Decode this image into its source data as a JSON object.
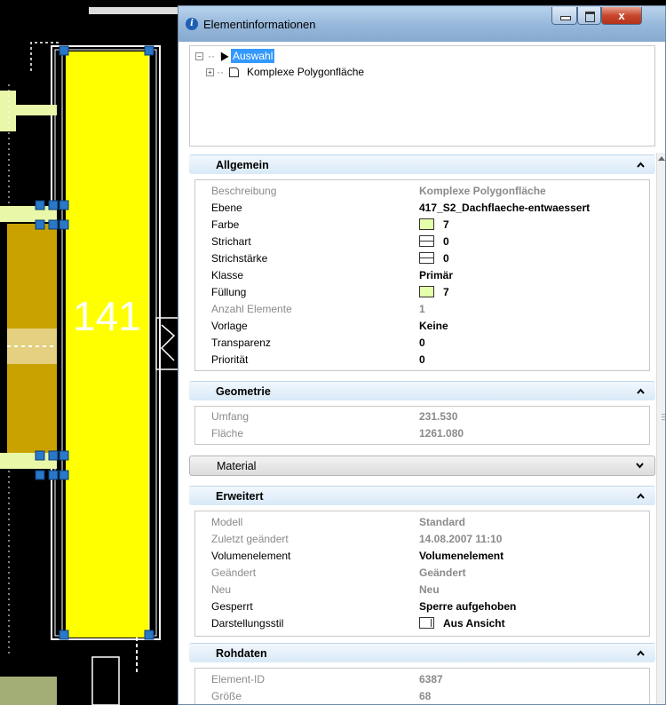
{
  "cad": {
    "label": "141"
  },
  "window": {
    "title": "Elementinformationen",
    "close_glyph": "x",
    "info_glyph": "i",
    "accent_color": "#3399ff",
    "fill_color": "#e6ffab",
    "icons": [
      "info-icon",
      "minimize-icon",
      "maximize-icon",
      "close-icon",
      "cursor-arrow-icon",
      "polygon-icon",
      "chevron-up-icon",
      "chevron-down-icon"
    ]
  },
  "tree": {
    "root": {
      "label": "Auswahl",
      "expander": "−"
    },
    "child": {
      "label": "Komplexe Polygonfläche",
      "expander": "+"
    }
  },
  "sections": {
    "allgemein": {
      "title": "Allgemein",
      "rows": [
        {
          "key": "Beschreibung",
          "value": "Komplexe Polygonfläche"
        },
        {
          "key": "Ebene",
          "value": "417_S2_Dachflaeche-entwaessert"
        },
        {
          "key": "Farbe",
          "value": "7"
        },
        {
          "key": "Strichart",
          "value": "0"
        },
        {
          "key": "Strichstärke",
          "value": "0"
        },
        {
          "key": "Klasse",
          "value": "Primär"
        },
        {
          "key": "Füllung",
          "value": "7"
        },
        {
          "key": "Anzahl Elemente",
          "value": "1"
        },
        {
          "key": "Vorlage",
          "value": "Keine"
        },
        {
          "key": "Transparenz",
          "value": "0"
        },
        {
          "key": "Priorität",
          "value": "0"
        }
      ]
    },
    "geometrie": {
      "title": "Geometrie",
      "rows": [
        {
          "key": "Umfang",
          "value": "231.530"
        },
        {
          "key": "Fläche",
          "value": "1261.080"
        }
      ]
    },
    "material": {
      "title": "Material"
    },
    "erweitert": {
      "title": "Erweitert",
      "rows": [
        {
          "key": "Modell",
          "value": "Standard"
        },
        {
          "key": "Zuletzt geändert",
          "value": "14.08.2007 11:10"
        },
        {
          "key": "Volumenelement",
          "value": "Volumenelement"
        },
        {
          "key": "Geändert",
          "value": "Geändert"
        },
        {
          "key": "Neu",
          "value": "Neu"
        },
        {
          "key": "Gesperrt",
          "value": "Sperre aufgehoben"
        },
        {
          "key": "Darstellungsstil",
          "value": "Aus Ansicht"
        }
      ]
    },
    "rohdaten": {
      "title": "Rohdaten",
      "rows": [
        {
          "key": "Element-ID",
          "value": "6387"
        },
        {
          "key": "Größe",
          "value": "68"
        }
      ]
    }
  }
}
